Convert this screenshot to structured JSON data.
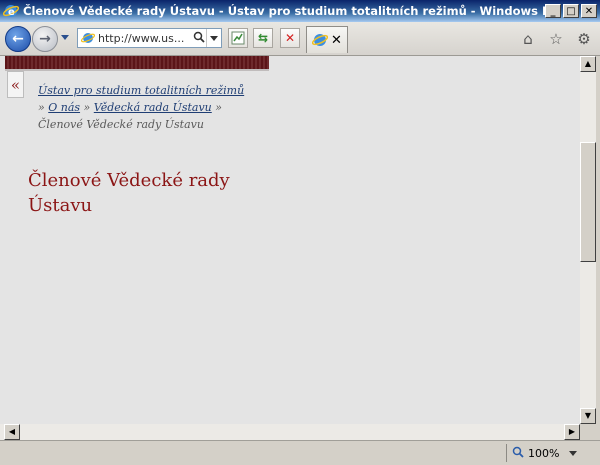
{
  "window": {
    "title": "Členové Vědecké rady Ústavu - Ústav pro studium totalitních režimů - Windows Internet E...",
    "minimize": "_",
    "maximize": "□",
    "close": "✕"
  },
  "navbar": {
    "address_url": "http://www.us...",
    "tab_close": "✕"
  },
  "page": {
    "collapse_glyph": "«",
    "breadcrumb": [
      {
        "label": "Ústav pro studium totalitních režimů",
        "link": true
      },
      {
        "label": " » ",
        "link": false
      },
      {
        "label": "O nás",
        "link": true
      },
      {
        "label": " » ",
        "link": false
      },
      {
        "label": "Vědecká rada Ústavu",
        "link": true
      },
      {
        "label": " » Členové Vědecké rady Ústavu",
        "link": false
      }
    ],
    "title": "Členové Vědecké rady Ústavu"
  },
  "status": {
    "zoom": "100%"
  },
  "colors": {
    "accent": "#8b1515",
    "link": "#1f3e74"
  }
}
